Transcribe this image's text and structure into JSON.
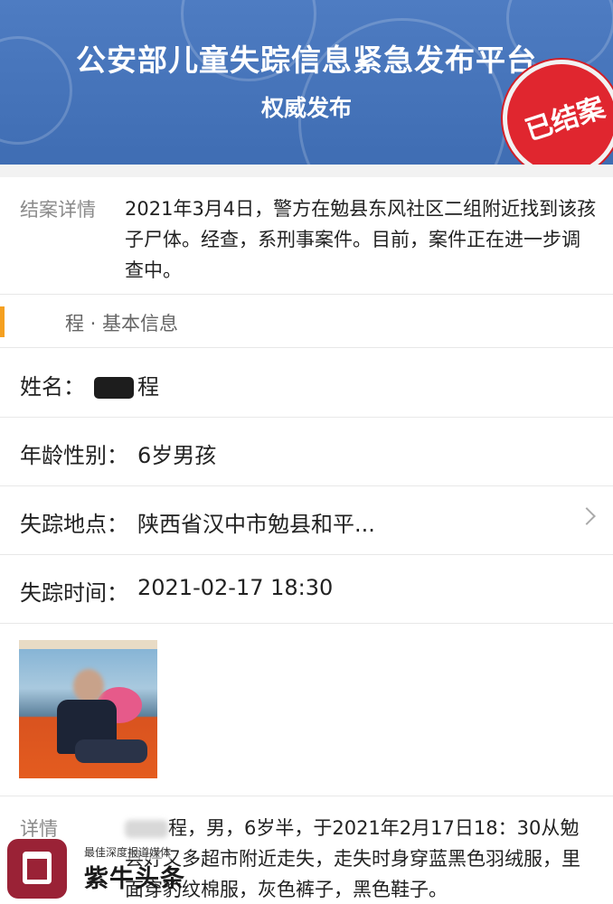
{
  "banner": {
    "title": "公安部儿童失踪信息紧急发布平台",
    "subtitle": "权威发布",
    "stamp": "已结案",
    "bg_color": "#4e7cc2"
  },
  "case": {
    "label": "结案详情",
    "text": "2021年3月4日，警方在勉县东风社区二组附近找到该孩子尸体。经查，系刑事案件。目前，案件正在进一步调查中。"
  },
  "section": {
    "label": "程 · 基本信息",
    "accent_color": "#f5a020"
  },
  "info": {
    "name_key": "姓名：",
    "name_val": "程",
    "age_key": "年龄性别：",
    "age_val": "6岁男孩",
    "location_key": "失踪地点：",
    "location_val": "陕西省汉中市勉县和平...",
    "time_key": "失踪时间：",
    "time_val": "2021-02-17 18:30"
  },
  "details": {
    "label": "详情",
    "text": "程，男，6岁半，于2021年2月17日18：30从勉县好又多超市附近走失，走失时身穿蓝黑色羽绒服，里面穿豹纹棉服，灰色裤子，黑色鞋子。"
  },
  "watermark": {
    "tagline": "最佳深度报道媒体",
    "brand": "紫牛头条"
  },
  "icons": {
    "chevron": "chevron-right-icon",
    "logo": "ziniu-logo-icon"
  }
}
